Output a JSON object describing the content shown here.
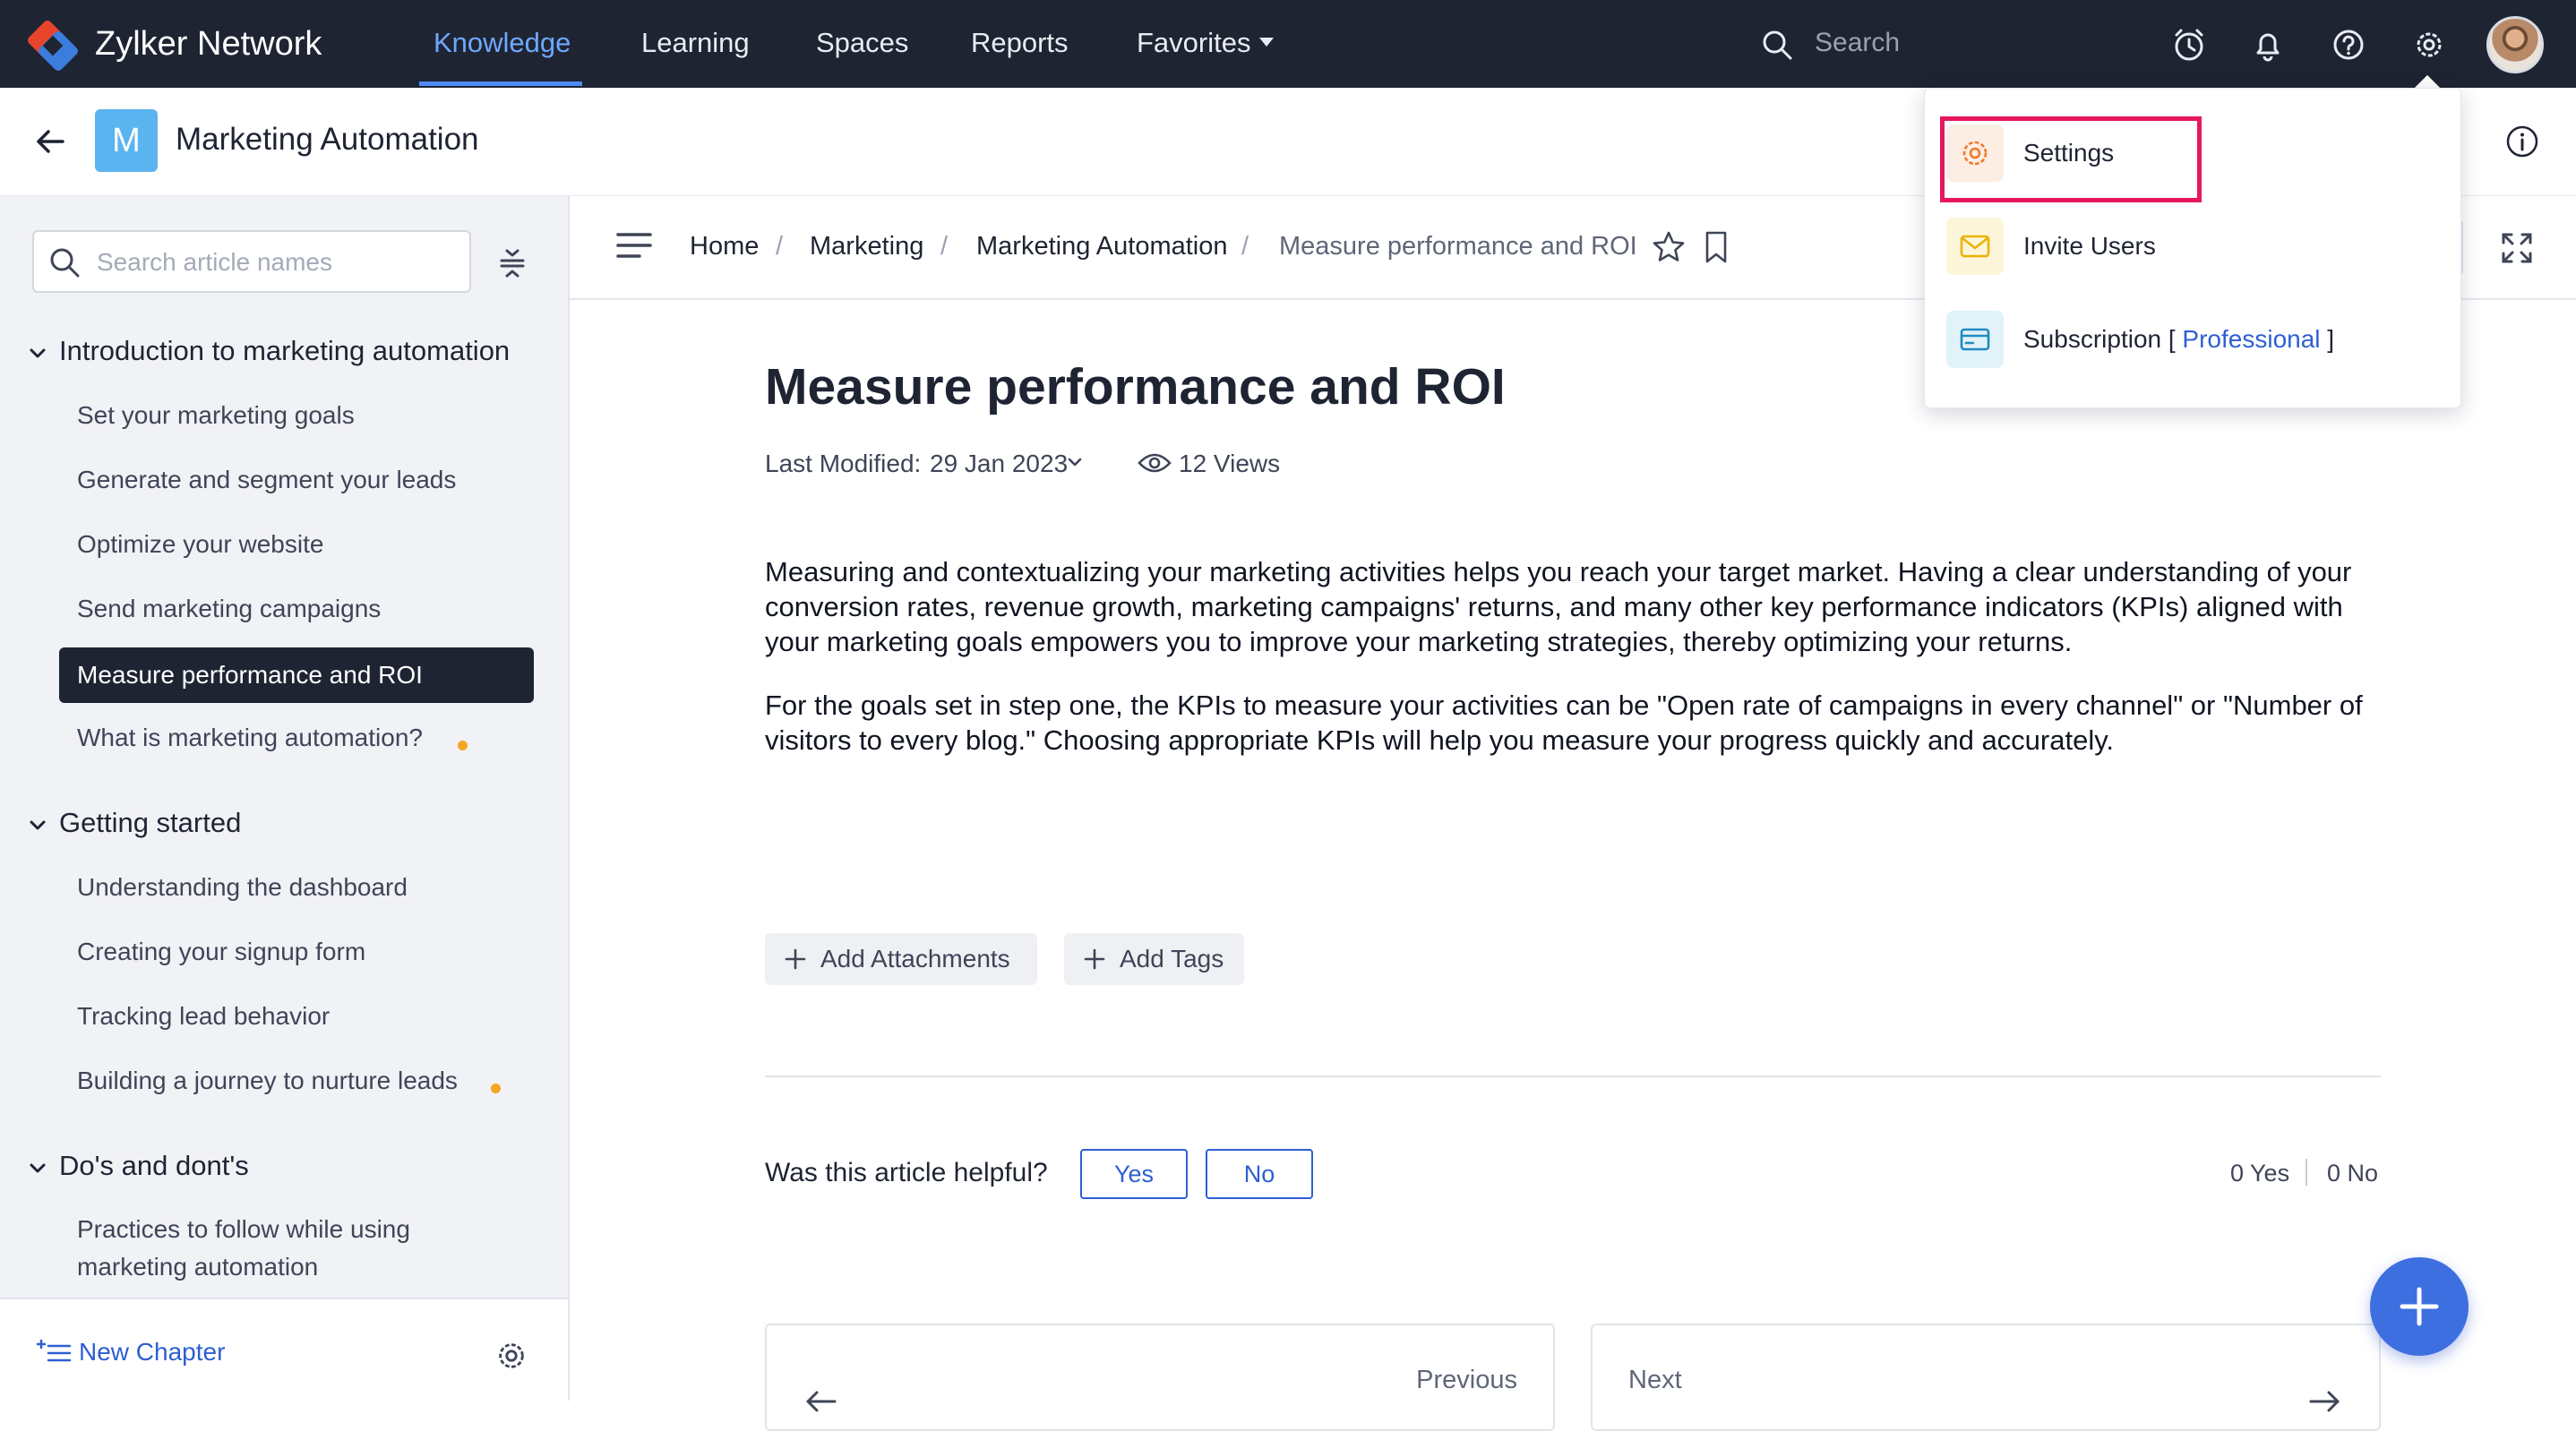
{
  "app": {
    "name": "Zylker Network"
  },
  "nav": {
    "items": [
      {
        "label": "Knowledge",
        "active": true
      },
      {
        "label": "Learning",
        "active": false
      },
      {
        "label": "Spaces",
        "active": false
      },
      {
        "label": "Reports",
        "active": false
      },
      {
        "label": "Favorites",
        "active": false,
        "has_dropdown": true
      }
    ],
    "search_placeholder": "Search",
    "icons": [
      "clock-icon",
      "bell-icon",
      "help-icon",
      "gear-icon",
      "avatar"
    ]
  },
  "space": {
    "badge_letter": "M",
    "badge_color": "#5ab4f0",
    "title": "Marketing Automation"
  },
  "sidebar": {
    "search_placeholder": "Search article names",
    "chapters": [
      {
        "title": "Introduction to marketing automation",
        "articles": [
          {
            "label": "Set your marketing goals"
          },
          {
            "label": "Generate and segment your leads"
          },
          {
            "label": "Optimize your website"
          },
          {
            "label": "Send marketing campaigns"
          },
          {
            "label": "Measure performance and ROI",
            "selected": true
          },
          {
            "label": "What is marketing automation?",
            "draft_dot": true
          }
        ]
      },
      {
        "title": "Getting started",
        "articles": [
          {
            "label": "Understanding the dashboard"
          },
          {
            "label": "Creating your signup form"
          },
          {
            "label": "Tracking lead behavior"
          },
          {
            "label": "Building a journey to nurture leads",
            "draft_dot": true
          }
        ]
      },
      {
        "title": "Do's and dont's",
        "articles": [
          {
            "label": "Practices to follow while using marketing automation"
          }
        ]
      }
    ],
    "new_chapter_label": "New Chapter"
  },
  "breadcrumb": [
    "Home",
    "Marketing",
    "Marketing Automation",
    "Measure performance and ROI"
  ],
  "article": {
    "title": "Measure performance and ROI",
    "last_modified_label": "Last Modified:",
    "last_modified_date": "29 Jan 2023",
    "views": "12 Views",
    "paragraphs": [
      "Measuring and contextualizing your marketing activities helps you reach your target market. Having a clear understanding of your conversion rates, revenue growth, marketing campaigns' returns, and many other key performance indicators (KPIs) aligned with your marketing goals empowers you to improve your marketing strategies, thereby optimizing your returns.",
      "For the goals set in step one, the KPIs to measure your activities can be \"Open rate of campaigns in every channel\" or \"Number of visitors to every blog.\" Choosing appropriate KPIs will help you measure your progress quickly and accurately."
    ],
    "add_attachments_label": "Add Attachments",
    "add_tags_label": "Add Tags",
    "helpful_question": "Was this article helpful?",
    "yes_label": "Yes",
    "no_label": "No",
    "yes_count": "0 Yes",
    "no_count": "0 No",
    "previous_label": "Previous",
    "next_label": "Next"
  },
  "settings_menu": {
    "items": [
      {
        "label": "Settings",
        "icon": "gear-icon",
        "color": "#f0792b"
      },
      {
        "label": "Invite Users",
        "icon": "mail-icon",
        "color": "#e9b300"
      },
      {
        "label": "Subscription [ ",
        "link": "Professional",
        "suffix": " ]",
        "icon": "card-icon",
        "color": "#1f8ac0"
      }
    ],
    "highlight_color": "#e6175c"
  },
  "colors": {
    "topbar": "#1f2433",
    "accent": "#2d5fd3",
    "active_nav": "#6ea8ff",
    "draft_dot": "#f5a623"
  }
}
